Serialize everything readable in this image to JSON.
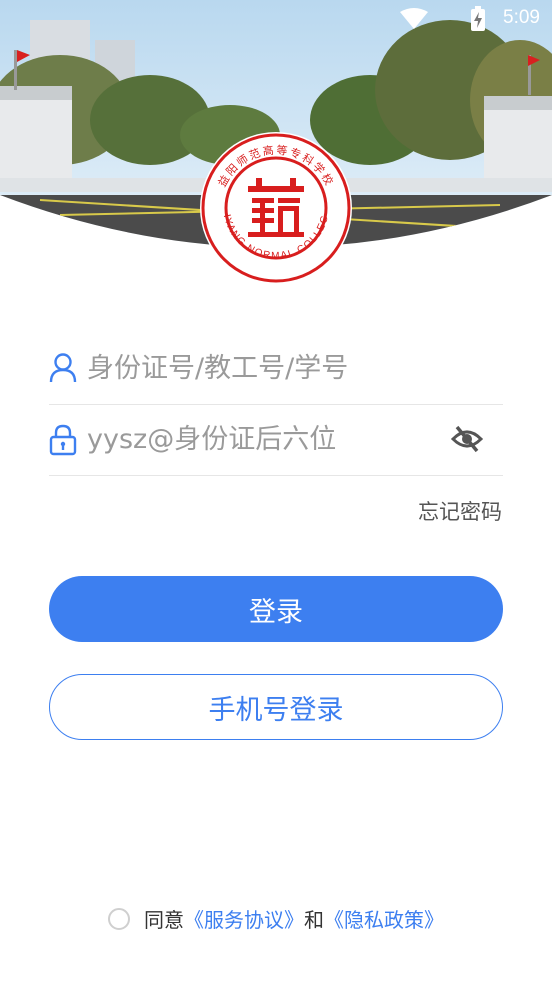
{
  "status_bar": {
    "time": "5:09"
  },
  "header": {
    "logo": {
      "name_cn": "益阳师范高等专科学校",
      "name_en": "YIYANG NORMAL COLLEGE"
    }
  },
  "form": {
    "account_placeholder": "身份证号/教工号/学号",
    "password_placeholder": "yysz@身份证后六位",
    "forgot_label": "忘记密码"
  },
  "buttons": {
    "login_label": "登录",
    "phone_login_label": "手机号登录"
  },
  "agreement": {
    "prefix": "同意",
    "service_link": "《服务协议》",
    "and": "和",
    "privacy_link": "《隐私政策》"
  },
  "colors": {
    "accent": "#3d7ff0",
    "logo_red": "#d81e1e"
  }
}
